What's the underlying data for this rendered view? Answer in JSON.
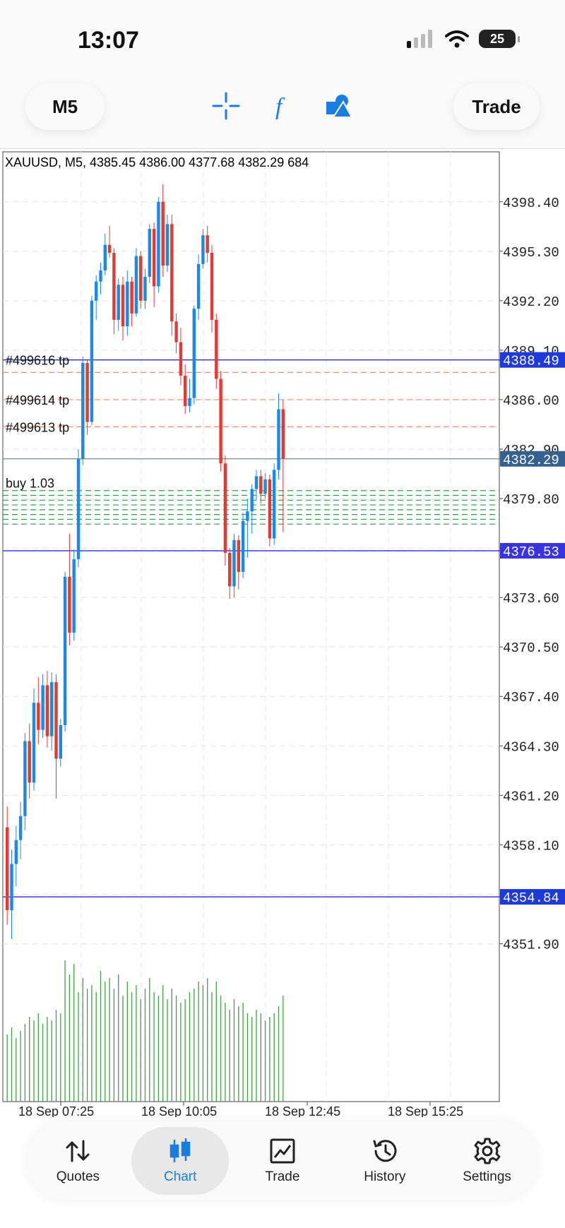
{
  "status_bar": {
    "time": "13:07",
    "battery": "25"
  },
  "toolbar": {
    "timeframe": "M5",
    "trade_label": "Trade",
    "icons": [
      "crosshair-icon",
      "indicator-f-icon",
      "objects-icon"
    ]
  },
  "chart_header": "XAUUSD, M5, 4385.45 4386.00 4377.68 4382.29 684",
  "price_axis": [
    "4398.40",
    "4395.30",
    "4392.20",
    "4389.10",
    "4386.00",
    "4382.90",
    "4379.80",
    "4376.70",
    "4373.60",
    "4370.50",
    "4367.40",
    "4364.30",
    "4361.20",
    "4358.10",
    "4355.00",
    "4351.90"
  ],
  "price_tags": [
    {
      "value": "4388.49",
      "color": "#1e3ad8"
    },
    {
      "value": "4382.29",
      "color": "#35618f"
    },
    {
      "value": "4376.53",
      "color": "#3a34e0"
    },
    {
      "value": "4354.84",
      "color": "#1e3ad8"
    }
  ],
  "tp_labels": [
    "#499616 tp",
    "#499614 tp",
    "#499613 tp"
  ],
  "buy_label": "buy 1.03",
  "time_axis": [
    "18 Sep 07:25",
    "18 Sep 10:05",
    "18 Sep 12:45",
    "18 Sep 15:25"
  ],
  "colors": {
    "bull": "#1e88e5",
    "bear": "#e53935",
    "volume": "#43a047",
    "accent": "#1a7de0"
  },
  "chart_data": {
    "type": "candlestick",
    "symbol": "XAUUSD",
    "timeframe": "M5",
    "ylim": [
      4349,
      4401
    ],
    "candles": [
      [
        4359.2,
        4360.5,
        4353.1,
        4354.0
      ],
      [
        4354.0,
        4357.8,
        4352.2,
        4356.9
      ],
      [
        4356.9,
        4359.3,
        4355.5,
        4358.4
      ],
      [
        4358.4,
        4360.8,
        4357.2,
        4359.9
      ],
      [
        4359.9,
        4365.1,
        4359.0,
        4364.6
      ],
      [
        4364.6,
        4365.7,
        4361.0,
        4362.0
      ],
      [
        4362.0,
        4367.9,
        4361.5,
        4367.0
      ],
      [
        4367.0,
        4368.6,
        4364.4,
        4365.3
      ],
      [
        4365.3,
        4368.8,
        4364.8,
        4368.1
      ],
      [
        4368.1,
        4369.0,
        4364.2,
        4364.9
      ],
      [
        4364.9,
        4368.9,
        4364.0,
        4368.3
      ],
      [
        4368.3,
        4368.8,
        4361.0,
        4363.5
      ],
      [
        4363.5,
        4366.0,
        4363.0,
        4365.6
      ],
      [
        4365.6,
        4375.2,
        4365.2,
        4374.9
      ],
      [
        4374.9,
        4377.6,
        4370.6,
        4371.4
      ],
      [
        4371.4,
        4376.6,
        4370.9,
        4376.0
      ],
      [
        4376.0,
        4382.9,
        4375.5,
        4382.3
      ],
      [
        4382.3,
        4388.7,
        4381.9,
        4388.3
      ],
      [
        4388.3,
        4388.5,
        4383.8,
        4384.6
      ],
      [
        4384.6,
        4392.5,
        4384.4,
        4392.2
      ],
      [
        4392.2,
        4393.8,
        4391.0,
        4393.4
      ],
      [
        4393.4,
        4394.6,
        4392.6,
        4394.1
      ],
      [
        4394.1,
        4396.4,
        4393.8,
        4395.7
      ],
      [
        4395.7,
        4396.9,
        4394.9,
        4395.2
      ],
      [
        4395.2,
        4395.5,
        4390.1,
        4391.0
      ],
      [
        4391.0,
        4393.6,
        4390.3,
        4393.2
      ],
      [
        4393.2,
        4393.7,
        4389.7,
        4390.6
      ],
      [
        4390.6,
        4394.1,
        4390.0,
        4393.4
      ],
      [
        4393.4,
        4393.7,
        4390.6,
        4391.4
      ],
      [
        4391.4,
        4395.5,
        4391.2,
        4395.0
      ],
      [
        4395.0,
        4395.3,
        4391.7,
        4392.2
      ],
      [
        4392.2,
        4394.2,
        4391.7,
        4393.7
      ],
      [
        4393.7,
        4397.0,
        4393.3,
        4396.7
      ],
      [
        4396.7,
        4397.1,
        4391.8,
        4393.1
      ],
      [
        4393.1,
        4398.7,
        4392.7,
        4398.4
      ],
      [
        4398.4,
        4399.5,
        4393.7,
        4394.4
      ],
      [
        4394.4,
        4397.6,
        4394.0,
        4397.0
      ],
      [
        4397.0,
        4397.6,
        4390.0,
        4390.9
      ],
      [
        4390.9,
        4391.4,
        4388.9,
        4389.6
      ],
      [
        4389.6,
        4390.5,
        4386.9,
        4387.5
      ],
      [
        4387.5,
        4388.2,
        4385.1,
        4385.6
      ],
      [
        4385.6,
        4387.3,
        4385.2,
        4386.1
      ],
      [
        4386.1,
        4391.9,
        4385.7,
        4391.7
      ],
      [
        4391.7,
        4395.1,
        4391.0,
        4394.5
      ],
      [
        4394.5,
        4396.7,
        4394.2,
        4396.3
      ],
      [
        4396.3,
        4396.9,
        4394.6,
        4395.2
      ],
      [
        4395.2,
        4395.7,
        4390.2,
        4391.0
      ],
      [
        4391.0,
        4391.4,
        4386.7,
        4387.3
      ],
      [
        4387.3,
        4387.8,
        4381.5,
        4382.0
      ],
      [
        4382.0,
        4382.5,
        4375.6,
        4376.4
      ],
      [
        4376.4,
        4376.7,
        4373.5,
        4374.3
      ],
      [
        4374.3,
        4377.6,
        4373.6,
        4377.2
      ],
      [
        4377.2,
        4377.5,
        4374.1,
        4375.2
      ],
      [
        4375.2,
        4378.9,
        4374.8,
        4378.4
      ],
      [
        4378.4,
        4379.8,
        4376.1,
        4379.0
      ],
      [
        4379.0,
        4380.7,
        4377.6,
        4380.4
      ],
      [
        4380.4,
        4381.6,
        4379.7,
        4381.2
      ],
      [
        4381.2,
        4381.6,
        4379.5,
        4380.1
      ],
      [
        4380.1,
        4381.4,
        4379.8,
        4381.0
      ],
      [
        4381.0,
        4381.3,
        4376.8,
        4377.3
      ],
      [
        4377.3,
        4382.0,
        4376.9,
        4381.6
      ],
      [
        4381.6,
        4386.4,
        4381.0,
        4385.4
      ],
      [
        4385.4,
        4386.0,
        4377.7,
        4382.3
      ]
    ],
    "volumes": [
      38,
      42,
      36,
      40,
      44,
      48,
      46,
      50,
      44,
      48,
      46,
      52,
      50,
      80,
      72,
      78,
      62,
      70,
      64,
      66,
      62,
      74,
      68,
      70,
      64,
      72,
      60,
      68,
      62,
      66,
      58,
      64,
      70,
      62,
      60,
      66,
      58,
      64,
      60,
      56,
      58,
      62,
      64,
      68,
      66,
      70,
      62,
      68,
      60,
      56,
      52,
      58,
      54,
      56,
      50,
      48,
      52,
      50,
      46,
      48,
      50,
      54,
      60
    ],
    "horizontal_lines": [
      4388.49,
      4376.53,
      4354.84
    ],
    "bid_line": 4382.29,
    "tp_lines": [
      4387.7,
      4386.0,
      4384.3
    ],
    "buy_lines": [
      4380.3,
      4380.0,
      4379.7,
      4379.4,
      4379.1,
      4378.8,
      4378.5,
      4378.2
    ]
  },
  "bottom_nav": [
    {
      "label": "Quotes",
      "icon": "quotes-arrows-icon",
      "active": false
    },
    {
      "label": "Chart",
      "icon": "candles-icon",
      "active": true
    },
    {
      "label": "Trade",
      "icon": "trade-chart-icon",
      "active": false
    },
    {
      "label": "History",
      "icon": "history-clock-icon",
      "active": false
    },
    {
      "label": "Settings",
      "icon": "settings-gear-icon",
      "active": false
    }
  ]
}
